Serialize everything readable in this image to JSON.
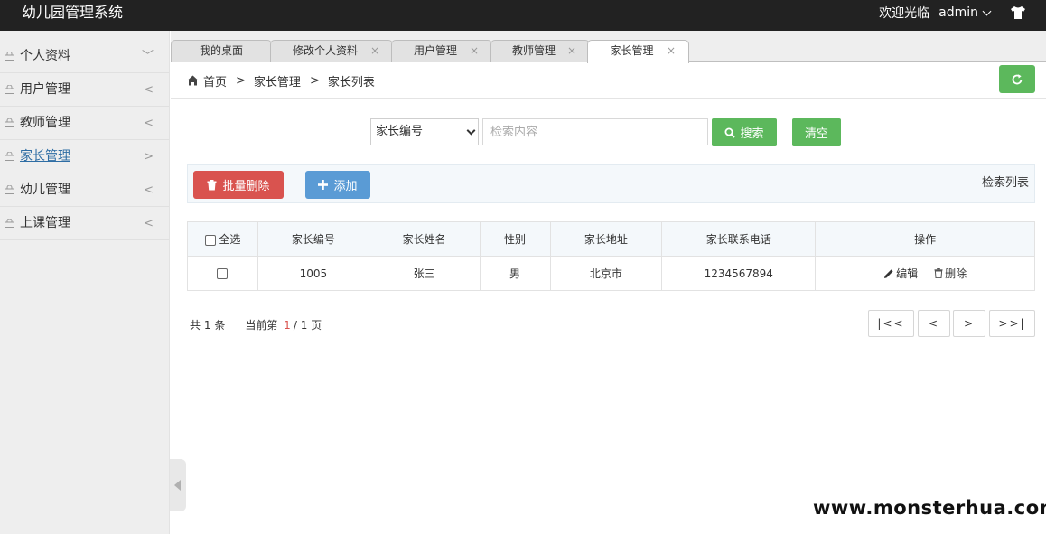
{
  "header": {
    "logo": "幼儿园管理系统",
    "welcome": "欢迎光临",
    "user": "admin",
    "bg_color": "#222222"
  },
  "sidebar": {
    "items": [
      {
        "label": "个人资料",
        "arrow": "﹀",
        "icon": "lock-icon"
      },
      {
        "label": "用户管理",
        "arrow": "<",
        "icon": "lock-icon"
      },
      {
        "label": "教师管理",
        "arrow": "<",
        "icon": "lock-icon"
      },
      {
        "label": "家长管理",
        "arrow": ">",
        "icon": "lock-icon",
        "active": true
      },
      {
        "label": "幼儿管理",
        "arrow": "<",
        "icon": "lock-icon"
      },
      {
        "label": "上课管理",
        "arrow": "<",
        "icon": "lock-icon"
      }
    ]
  },
  "tabs": [
    {
      "label": "我的桌面",
      "closable": false
    },
    {
      "label": "修改个人资料",
      "close": "×"
    },
    {
      "label": "用户管理",
      "close": "×"
    },
    {
      "label": "教师管理",
      "close": "×"
    },
    {
      "label": "家长管理",
      "close": "×",
      "active": true
    }
  ],
  "breadcrumb": {
    "home": "首页",
    "sep1": ">",
    "level1": "家长管理",
    "sep2": ">",
    "level2": "家长列表"
  },
  "search": {
    "field_selected": "家长编号",
    "placeholder": "检索内容",
    "search_label": "搜索",
    "clear_label": "清空"
  },
  "toolbar": {
    "delete_label": "批量删除",
    "add_label": "添加",
    "title": "检索列表"
  },
  "table": {
    "headers": {
      "select_all": "全选",
      "parent_id": "家长编号",
      "parent_name": "家长姓名",
      "gender": "性别",
      "address": "家长地址",
      "phone": "家长联系电话",
      "actions": "操作"
    },
    "rows": [
      {
        "parent_id": "1005",
        "parent_name": "张三",
        "gender": "男",
        "address": "北京市",
        "phone": "1234567894",
        "edit": "编辑",
        "delete": "删除"
      }
    ]
  },
  "pagination": {
    "total_prefix": "共",
    "total": "1",
    "total_suffix": "条",
    "current_prefix": "当前第",
    "current": "1",
    "pages_sep": "/",
    "pages": "1",
    "pages_suffix": "页",
    "first": "|<<",
    "prev": "<",
    "next": ">",
    "last": ">>|"
  },
  "colors": {
    "green": "#5cb85c",
    "red": "#d9534f",
    "blue": "#5a9bd5",
    "active_link": "#2e6da4"
  },
  "watermark": "www.monsterhua.com"
}
